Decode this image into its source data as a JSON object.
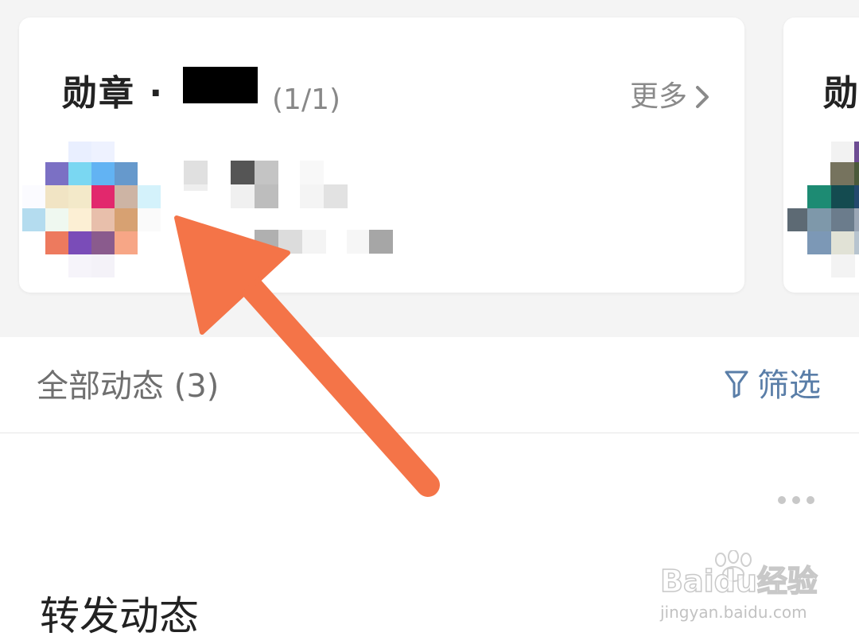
{
  "badge_card": {
    "title": "勋章 ·",
    "count": "(1/1)",
    "more_label": "更多",
    "more_icon": "chevron-right-icon",
    "badge_image": "pixelated-badge-image",
    "peek_title": "勋"
  },
  "feed": {
    "all_label": "全部动态 (3)",
    "filter_label": "筛选",
    "filter_icon": "funnel-icon",
    "more_menu_icon": "more-dots-icon",
    "post_title": "转发动态"
  },
  "watermark": {
    "main": "Baidu经验",
    "sub": "jingyan.baidu.com"
  },
  "colors": {
    "arrow": "#f47448",
    "filter_accent": "#5a7ea8"
  }
}
